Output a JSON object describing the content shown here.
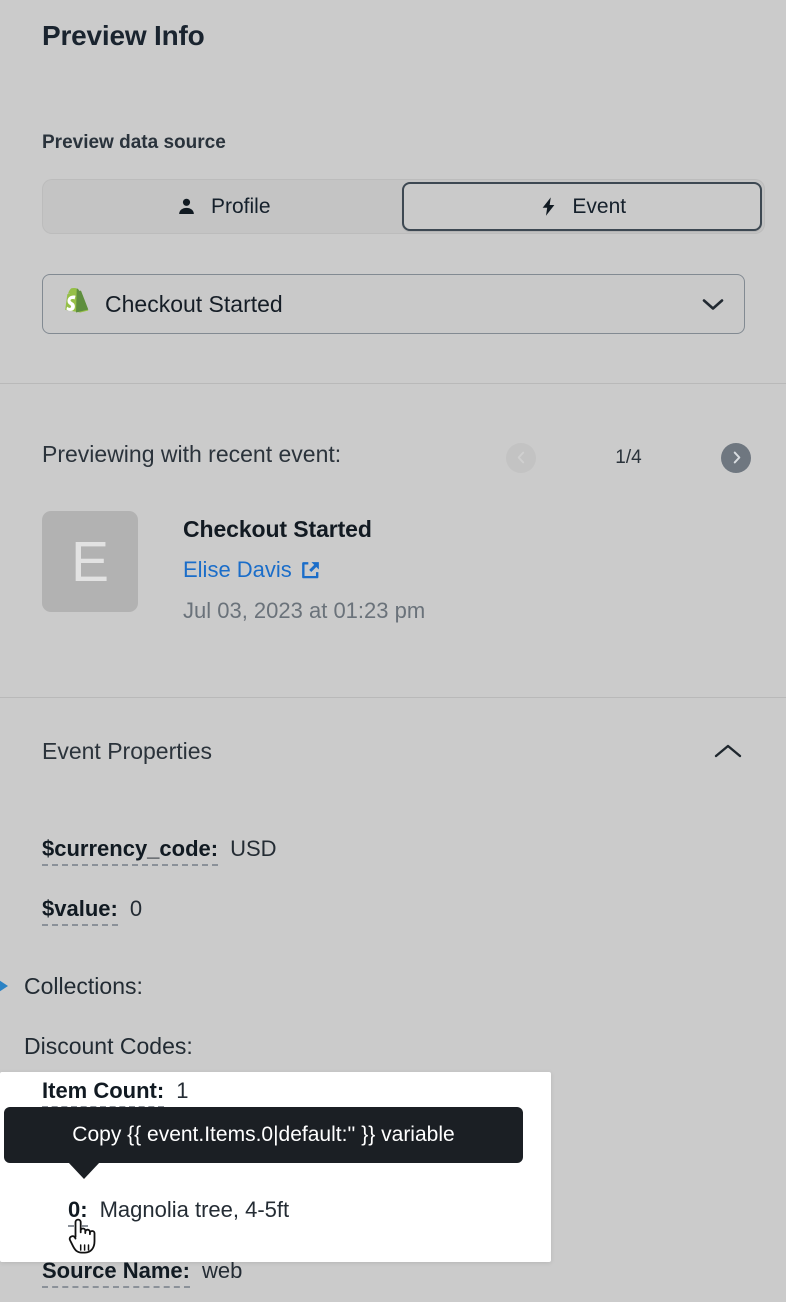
{
  "panel": {
    "title": "Preview Info"
  },
  "data_source": {
    "label": "Preview data source",
    "options": [
      {
        "label": "Profile",
        "icon": "person-icon",
        "selected": false
      },
      {
        "label": "Event",
        "icon": "lightning-bolt-icon",
        "selected": true
      }
    ],
    "event_select": {
      "value": "Checkout Started",
      "icon": "shopify-icon",
      "chevron": "chevron-down-icon"
    }
  },
  "recent_event": {
    "heading": "Previewing with recent event:",
    "pager": {
      "prev_icon": "chevron-left-circle-icon",
      "next_icon": "chevron-right-circle-icon",
      "count": "1/4"
    },
    "avatar_initial": "E",
    "name": "Checkout Started",
    "person": "Elise Davis",
    "person_icon": "external-link-icon",
    "timestamp": "Jul 03, 2023 at 01:23 pm"
  },
  "event_properties": {
    "title": "Event Properties",
    "collapse_icon": "chevron-up-icon",
    "rows": [
      {
        "type": "pair",
        "key": "$currency_code:",
        "value": "USD"
      },
      {
        "type": "pair",
        "key": "$value:",
        "value": "0"
      },
      {
        "type": "group",
        "label": "Collections:",
        "caret": "caret-right-icon",
        "expandable": true
      },
      {
        "type": "group",
        "label": "Discount Codes:",
        "caret": "caret-right-icon",
        "expandable": false
      }
    ],
    "item_count": {
      "key": "Item Count:",
      "value": "1"
    },
    "item_zero": {
      "key": "0:",
      "value": "Magnolia tree, 4-5ft"
    },
    "source_name": {
      "key": "Source Name:",
      "value": "web"
    }
  },
  "tooltip": {
    "text": "Copy {{ event.Items.0|default:'' }} variable"
  },
  "colors": {
    "page_background": "#cbcbcb",
    "link_blue": "#1a6dc9",
    "caret_blue": "#2b82c4",
    "tooltip_background": "#1b1f24",
    "shopify_green": "#7ab55c",
    "sheet_white": "#ffffff"
  },
  "cursor": {
    "icon": "pointing-hand-cursor"
  }
}
